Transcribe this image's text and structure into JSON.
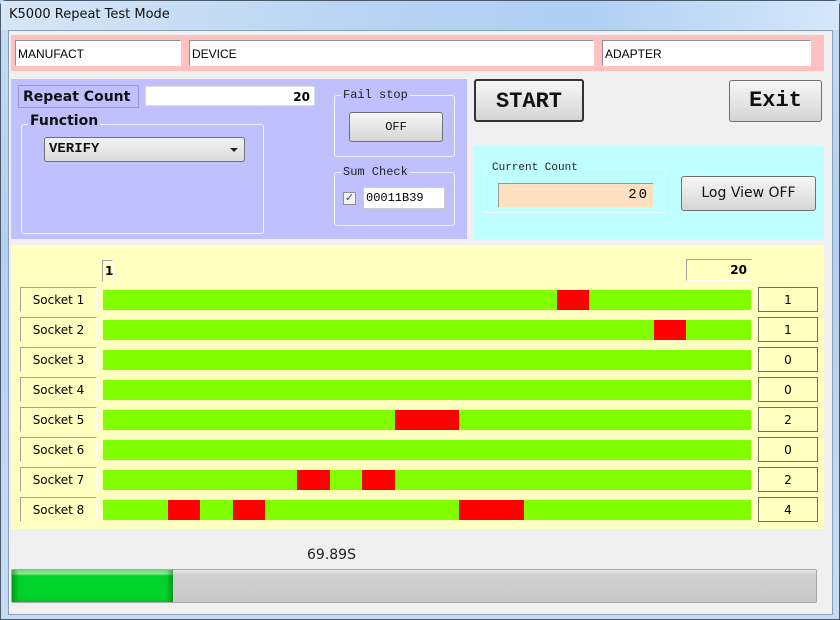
{
  "window": {
    "title": "K5000 Repeat Test Mode"
  },
  "header": {
    "manufacturer": "MANUFACT",
    "device": "DEVICE",
    "adapter": "ADAPTER"
  },
  "settings": {
    "repeat_count_label": "Repeat Count",
    "repeat_count_value": "20",
    "function_label": "Function",
    "function_selected": "VERIFY",
    "fail_stop_label": "Fail stop",
    "fail_stop_button": "OFF",
    "sum_check_label": "Sum Check",
    "sum_check_checked": true,
    "sum_check_checkmark": "✓",
    "sum_check_value": "00011B39"
  },
  "actions": {
    "start_label": "START",
    "exit_label": "Exit",
    "log_view_label": "Log View OFF"
  },
  "status": {
    "current_count_label": "Current Count",
    "current_count_value": "20",
    "elapsed_time": "69.89S",
    "progress_percent": 20
  },
  "colors": {
    "pass": "#80ff00",
    "fail": "#ff0000",
    "progress": "#00d32c"
  },
  "results": {
    "first_iteration_label": "1",
    "last_iteration_label": "20",
    "total_iterations": 20,
    "sockets": [
      {
        "label": "Socket 1",
        "fail_count": "1",
        "failed_iterations": [
          15
        ]
      },
      {
        "label": "Socket 2",
        "fail_count": "1",
        "failed_iterations": [
          18
        ]
      },
      {
        "label": "Socket 3",
        "fail_count": "0",
        "failed_iterations": []
      },
      {
        "label": "Socket 4",
        "fail_count": "0",
        "failed_iterations": []
      },
      {
        "label": "Socket 5",
        "fail_count": "2",
        "failed_iterations": [
          10,
          11
        ]
      },
      {
        "label": "Socket 6",
        "fail_count": "0",
        "failed_iterations": []
      },
      {
        "label": "Socket 7",
        "fail_count": "2",
        "failed_iterations": [
          7,
          9
        ]
      },
      {
        "label": "Socket 8",
        "fail_count": "4",
        "failed_iterations": [
          3,
          5,
          12,
          13
        ]
      }
    ]
  }
}
